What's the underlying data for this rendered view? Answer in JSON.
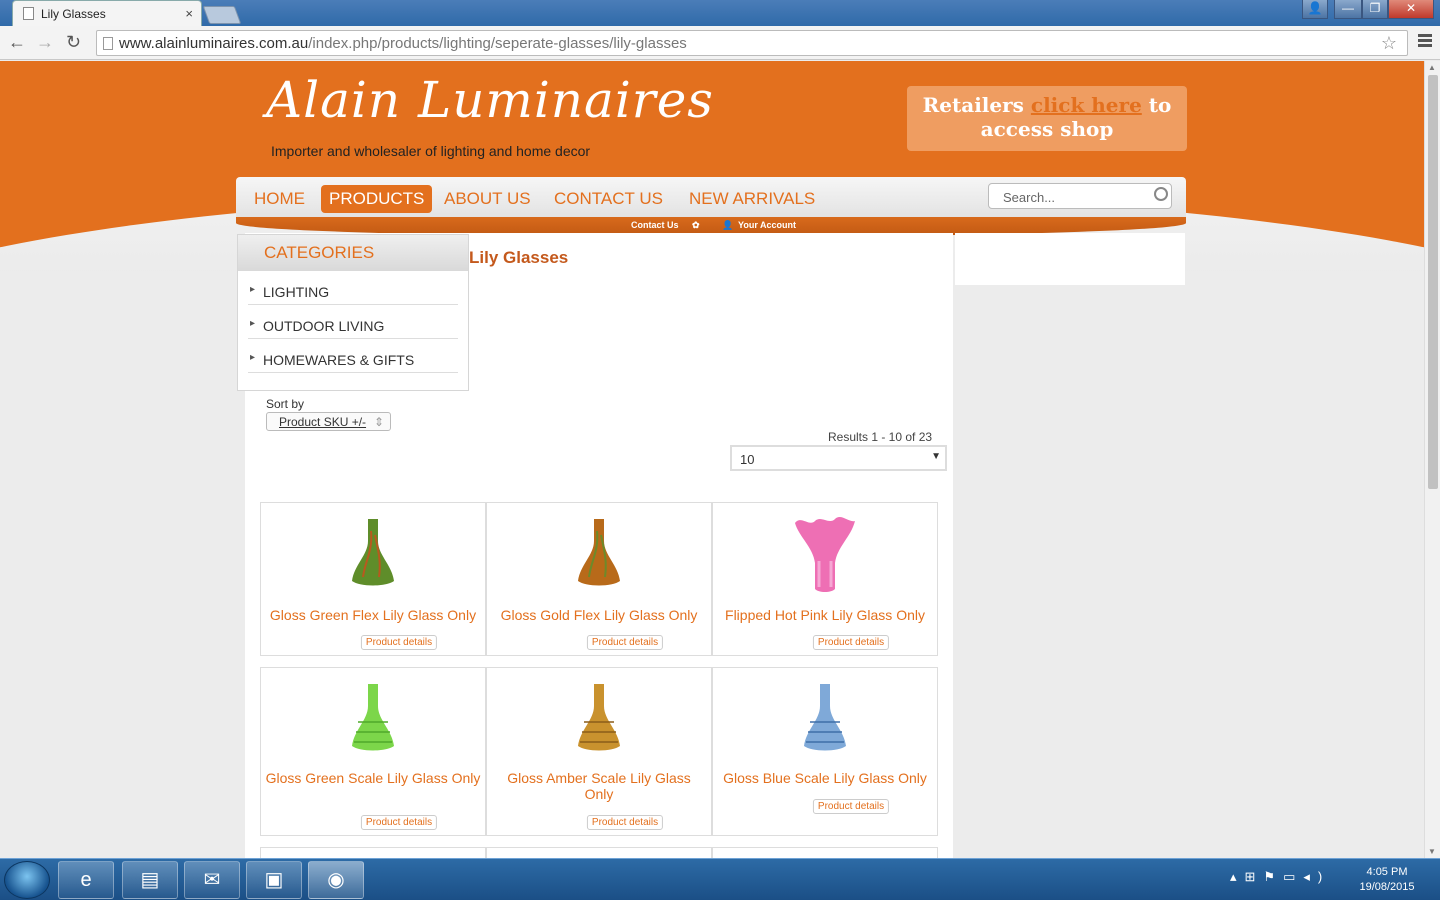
{
  "browser": {
    "tab_title": "Lily Glasses",
    "tab_close": "×",
    "url_host": "www.alainluminaires.com.au",
    "url_path": "/index.php/products/lighting/seperate-glasses/lily-glasses"
  },
  "window_controls": {
    "user": "👤",
    "minimize": "—",
    "restore": "❐",
    "close": "✕"
  },
  "nav_glyphs": {
    "back": "←",
    "forward": "→",
    "reload": "↻",
    "star": "☆"
  },
  "header": {
    "logo_text": "Alain Luminaires",
    "tagline": "Importer and wholesaler of lighting and home decor",
    "retailers_pre": "Retailers ",
    "retailers_link": "click here",
    "retailers_post": " to access shop"
  },
  "nav": {
    "items": [
      "HOME",
      "PRODUCTS",
      "ABOUT US",
      "CONTACT US",
      "NEW ARRIVALS"
    ],
    "active": "PRODUCTS",
    "search_placeholder": "Search..."
  },
  "subnav": {
    "contact": "Contact Us",
    "account": "Your Account"
  },
  "categories": {
    "heading": "CATEGORIES",
    "items": [
      "LIGHTING",
      "OUTDOOR LIVING",
      "HOMEWARES & GIFTS"
    ]
  },
  "page": {
    "title": "Lily Glasses",
    "sort_label": "Sort by",
    "sort_value": "Product SKU +/-",
    "results_text": "Results 1 - 10 of 23",
    "per_page": "10"
  },
  "products": [
    {
      "name": "Gloss Green Flex Lily Glass Only",
      "details": "Product details",
      "color": "#5f8d2a",
      "accent": "#b9591e"
    },
    {
      "name": "Gloss Gold Flex Lily Glass Only",
      "details": "Product details",
      "color": "#b86a1a",
      "accent": "#6d8a2a"
    },
    {
      "name": "Flipped Hot Pink Lily Glass Only",
      "details": "Product details",
      "color": "#ee6fb4",
      "accent": "#f6a7d4"
    },
    {
      "name": "Gloss Green Scale Lily Glass Only",
      "details": "Product details",
      "color": "#7cd64a",
      "accent": "#4ea82a"
    },
    {
      "name": "Gloss Amber Scale Lily Glass Only",
      "details": "Product details",
      "color": "#c9922e",
      "accent": "#8a5c18"
    },
    {
      "name": "Gloss Blue Scale Lily Glass Only",
      "details": "Product details",
      "color": "#7fa9d8",
      "accent": "#3f6fa8"
    }
  ],
  "taskbar": {
    "apps": [
      "ie-icon",
      "explorer-icon",
      "outlook-icon",
      "monitor-icon",
      "chrome-icon"
    ],
    "time": "4:05 PM",
    "date": "19/08/2015"
  },
  "colors": {
    "brand_orange": "#e3701e",
    "page_bg": "#ececec"
  }
}
